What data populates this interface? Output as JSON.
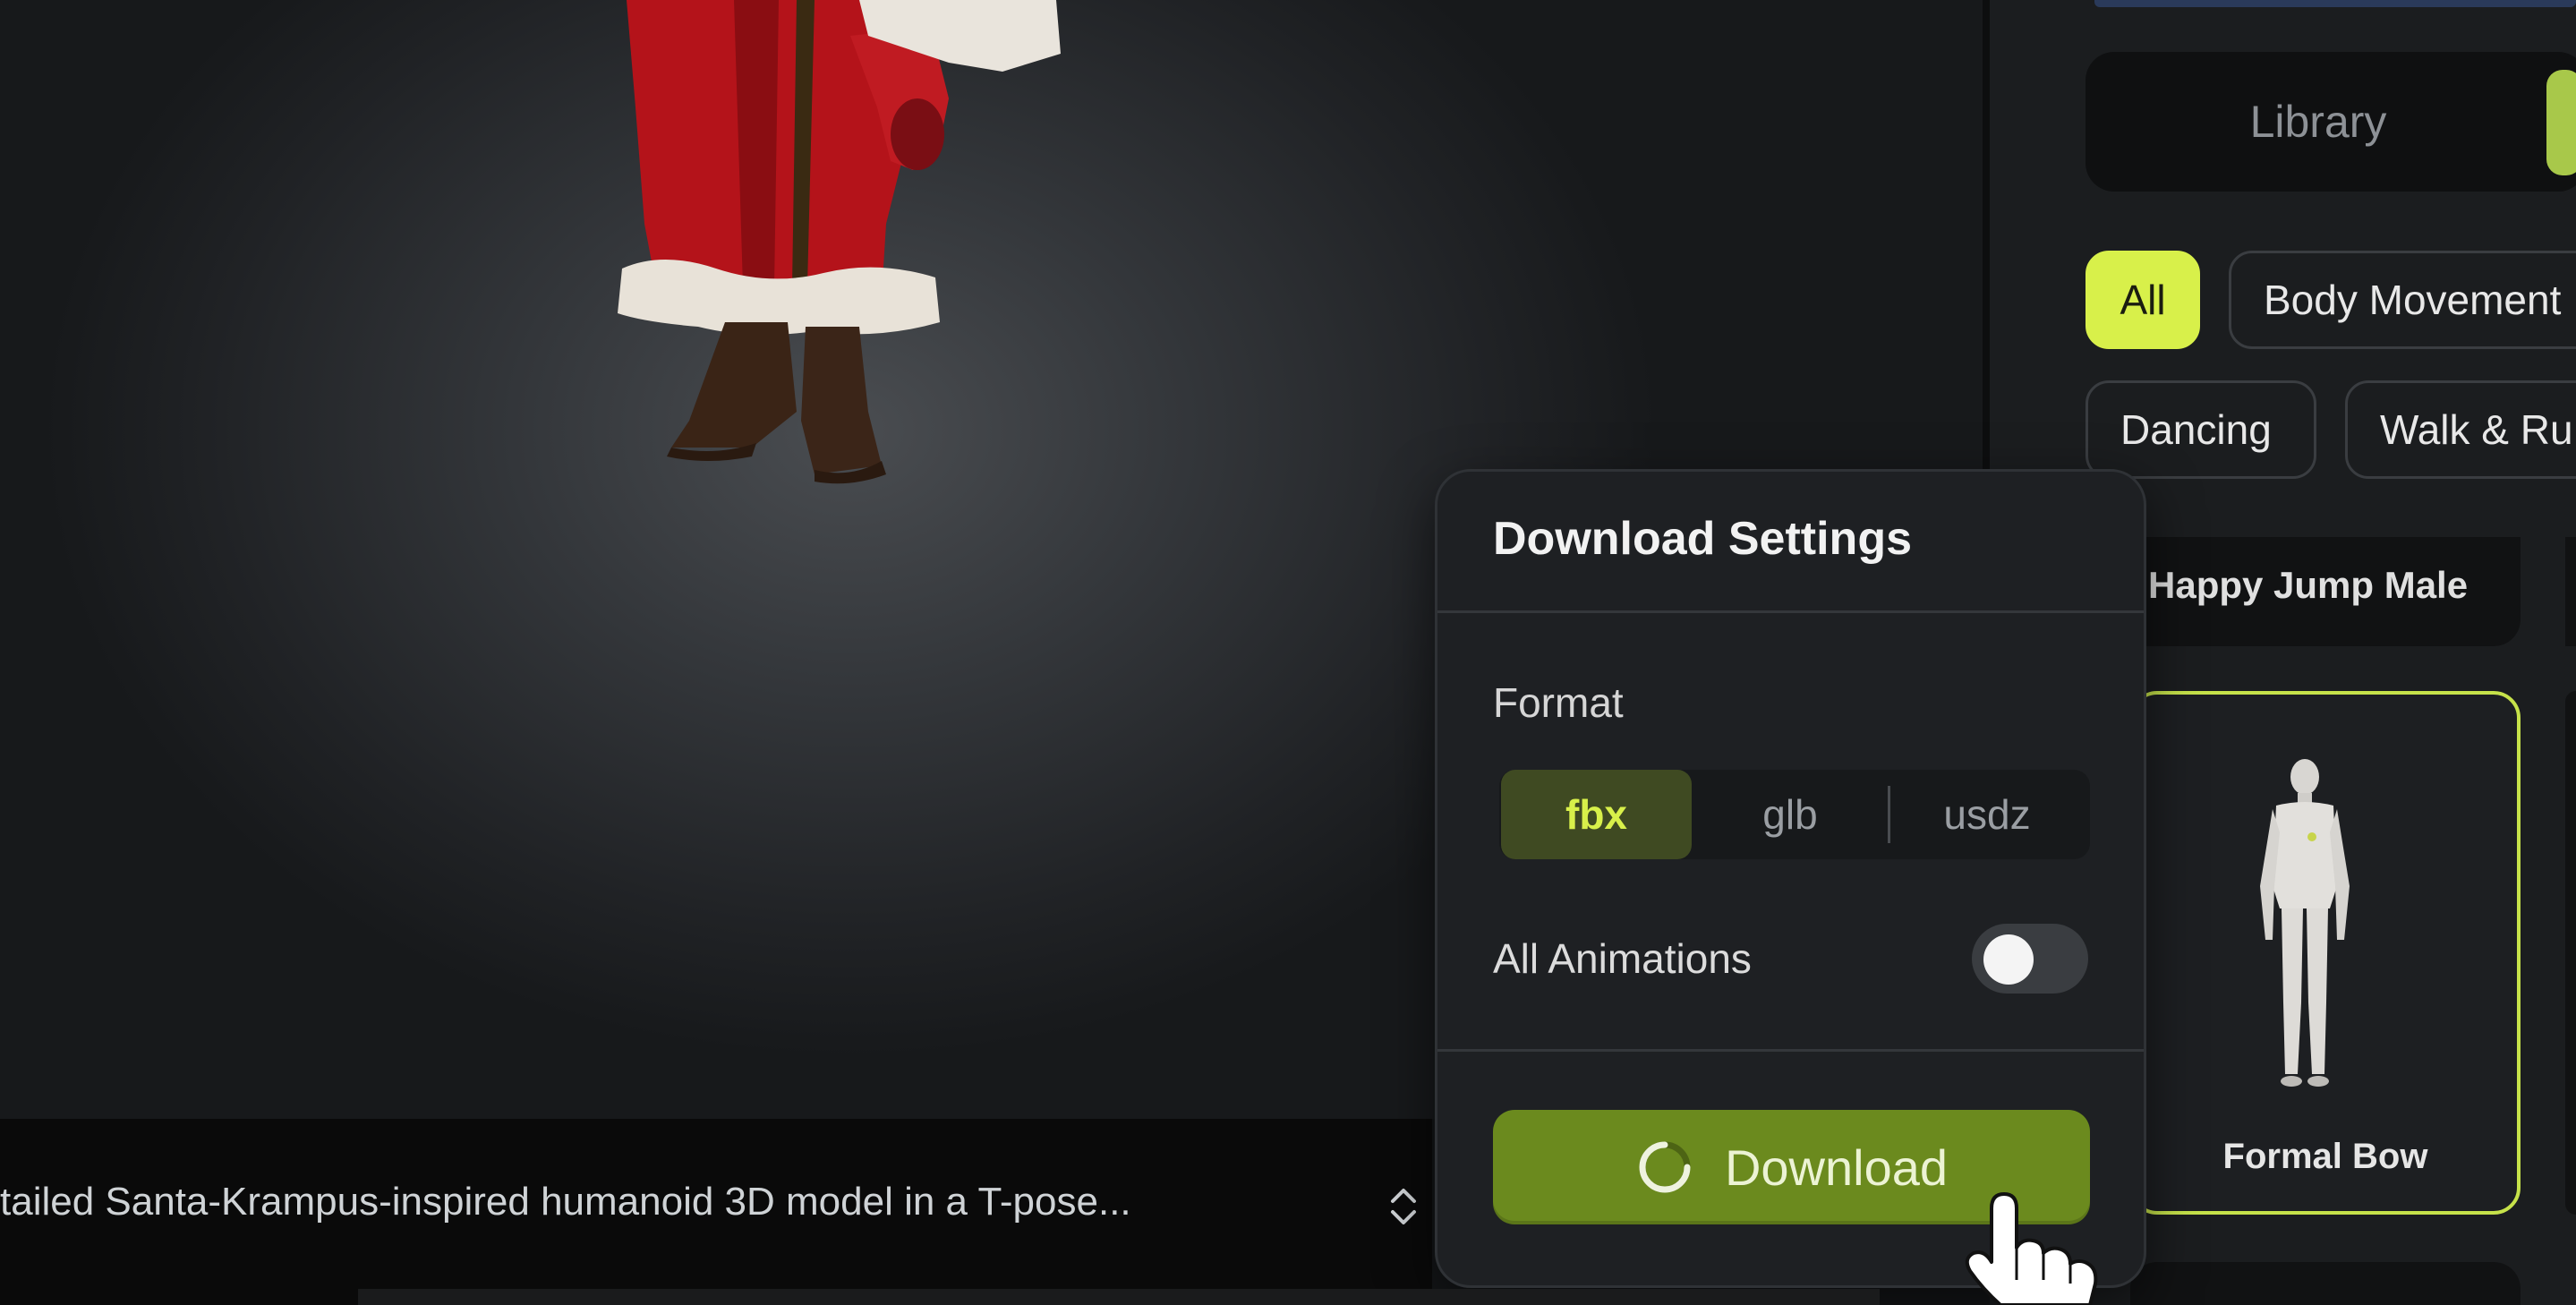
{
  "prompt": {
    "text": "tailed Santa-Krampus-inspired humanoid 3D model in a T-pose..."
  },
  "library_panel": {
    "tab_library": "Library",
    "filters": [
      "All",
      "Body Movement",
      "Dancing",
      "Walk & Ru"
    ],
    "cards": [
      {
        "label": "Happy Jump Male"
      },
      {
        "label": "Formal Bow"
      }
    ]
  },
  "download_settings": {
    "title": "Download Settings",
    "format_label": "Format",
    "formats": [
      "fbx",
      "glb",
      "usdz"
    ],
    "selected_format": "fbx",
    "all_animations_label": "All Animations",
    "all_animations_enabled": false,
    "download_label": "Download"
  },
  "colors": {
    "accent": "#d8f04a",
    "download_button": "#6b8a1e",
    "selected_card_border": "#c6e24a"
  },
  "icons": [
    "chevron-up-down-icon",
    "loading-spinner-icon",
    "hand-pointer-cursor-icon"
  ]
}
